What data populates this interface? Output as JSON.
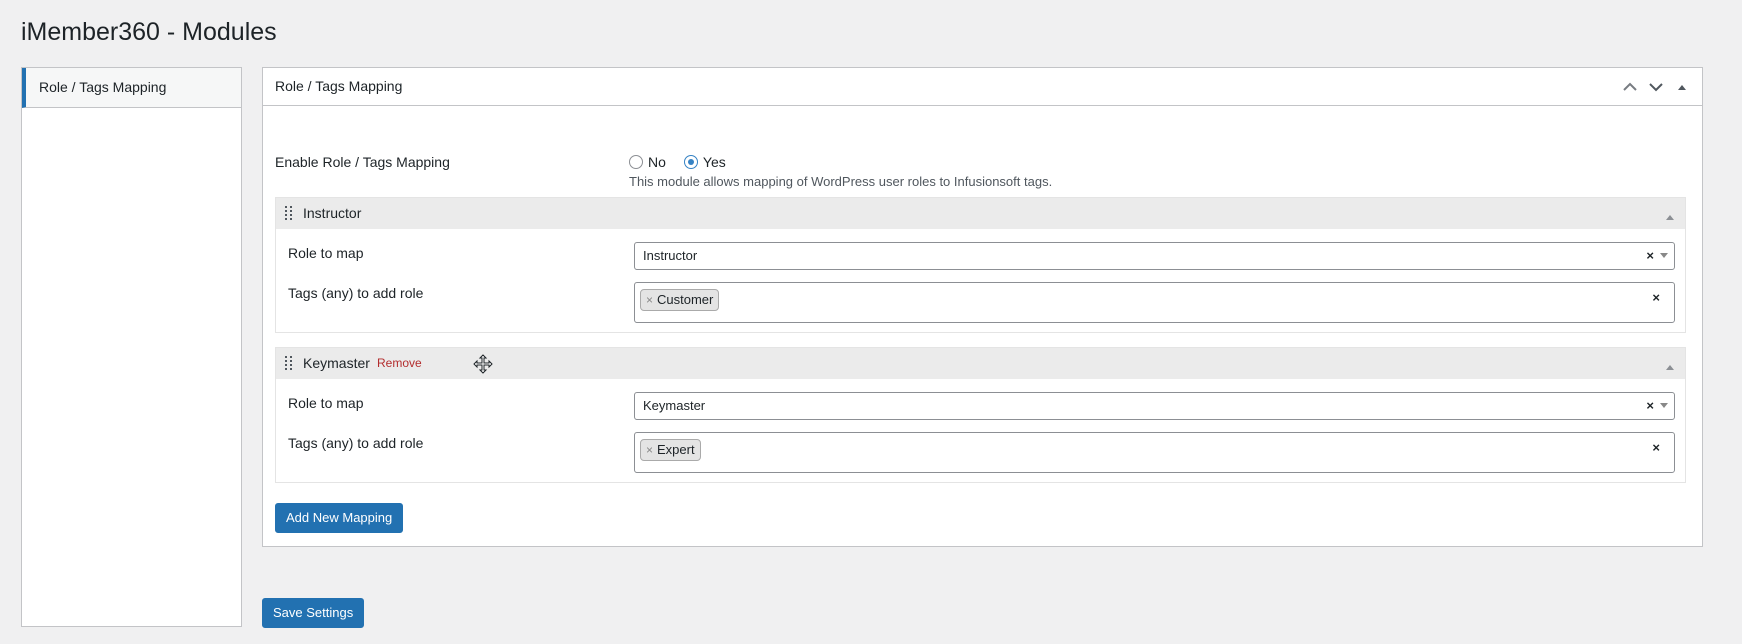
{
  "page": {
    "title": "iMember360 - Modules"
  },
  "sidebar": {
    "items": [
      {
        "label": "Role / Tags Mapping",
        "active": true
      }
    ]
  },
  "panel": {
    "title": "Role / Tags Mapping",
    "handle_icons": [
      "chevron-up-icon",
      "chevron-down-icon",
      "triangle-up-icon"
    ],
    "enable": {
      "label": "Enable Role / Tags Mapping",
      "options": [
        {
          "label": "No",
          "checked": false
        },
        {
          "label": "Yes",
          "checked": true
        }
      ],
      "description": "This module allows mapping of WordPress user roles to Infusionsoft tags."
    },
    "mappings": [
      {
        "title": "Instructor",
        "remove_label": "",
        "role_label": "Role to map",
        "role_value": "Instructor",
        "tags_label": "Tags (any) to add role",
        "tags": [
          "Customer"
        ]
      },
      {
        "title": "Keymaster",
        "remove_label": "Remove",
        "role_label": "Role to map",
        "role_value": "Keymaster",
        "tags_label": "Tags (any) to add role",
        "tags": [
          "Expert"
        ]
      }
    ],
    "add_button": "Add New Mapping"
  },
  "save_button": "Save Settings",
  "colors": {
    "accent": "#2271b1",
    "remove": "#b32d2e",
    "group_header": "#ebebeb"
  }
}
